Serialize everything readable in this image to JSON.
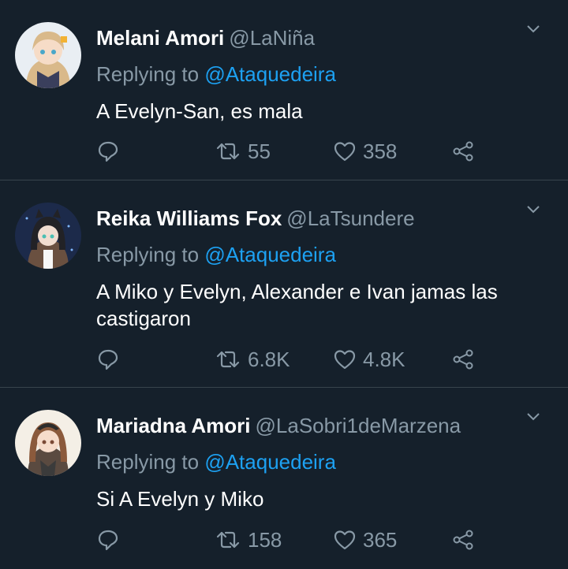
{
  "tweets": [
    {
      "name": "Melani Amori",
      "handle": "@LaNiña",
      "replying_prefix": "Replying to",
      "replying_to": "@Ataquedeira",
      "text": "A Evelyn-San, es mala",
      "retweets": "55",
      "likes": "358"
    },
    {
      "name": "Reika Williams Fox",
      "handle": "@LaTsundere",
      "replying_prefix": "Replying to",
      "replying_to": "@Ataquedeira",
      "text": "A Miko y Evelyn, Alexander e Ivan jamas las castigaron",
      "retweets": "6.8K",
      "likes": "4.8K"
    },
    {
      "name": "Mariadna Amori",
      "handle": "@LaSobri1deMarzena",
      "replying_prefix": "Replying to",
      "replying_to": "@Ataquedeira",
      "text": "Si A Evelyn y Miko",
      "retweets": "158",
      "likes": "365"
    }
  ],
  "colors": {
    "background": "#15202b",
    "divider": "#38444d",
    "secondary_text": "#8899a6",
    "link": "#1da1f2"
  },
  "icons": [
    "reply-icon",
    "retweet-icon",
    "like-icon",
    "share-icon",
    "chevron-down-icon"
  ]
}
